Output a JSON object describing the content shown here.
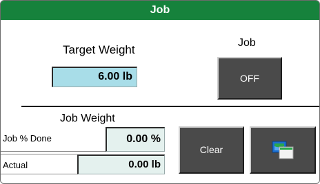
{
  "window": {
    "title": "Job"
  },
  "target": {
    "label": "Target Weight",
    "value": "6.00 lb"
  },
  "job": {
    "label": "Job",
    "button_label": "OFF"
  },
  "job_weight": {
    "label": "Job Weight",
    "percent_done": {
      "label": "Job % Done",
      "value": "0.00 %"
    },
    "actual": {
      "label": "Actual",
      "value": "0.00 lb"
    }
  },
  "actions": {
    "clear_label": "Clear",
    "screen_icon": "switch-screen-icon"
  },
  "colors": {
    "title_bar": "#16823c",
    "target_field": "#a8dde8",
    "value_field": "#e4f1ee",
    "button": "#4a4a4a",
    "icon_blue": "#1b6fd1",
    "icon_green": "#2aa84a"
  }
}
